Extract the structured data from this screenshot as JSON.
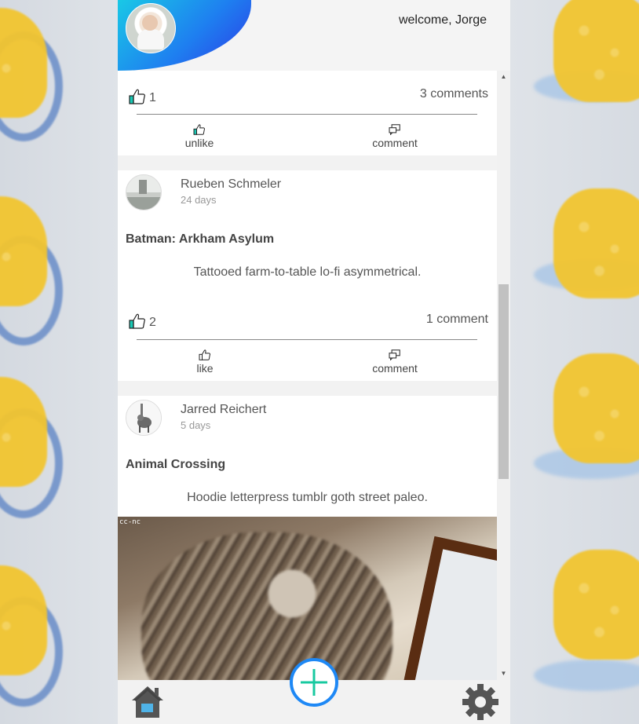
{
  "header": {
    "welcome_text": "welcome, Jorge"
  },
  "posts": [
    {
      "likes": "1",
      "comments_label": "3 comments",
      "like_action_label": "unlike",
      "comment_action_label": "comment"
    },
    {
      "author": "Rueben Schmeler",
      "time": "24 days",
      "title": "Batman: Arkham Asylum",
      "body": "Tattooed farm-to-table lo-fi asymmetrical.",
      "likes": "2",
      "comments_label": "1 comment",
      "like_action_label": "like",
      "comment_action_label": "comment"
    },
    {
      "author": "Jarred Reichert",
      "time": "5 days",
      "title": "Animal Crossing",
      "body": "Hoodie letterpress tumblr goth street paleo.",
      "image_caption": "cc-nc"
    }
  ],
  "colors": {
    "accent": "#1e88f5",
    "like_active": "#19c8b4",
    "add_icon": "#18c9a0"
  },
  "icons": [
    "thumbs-up-icon",
    "comment-icon",
    "home-icon",
    "plus-icon",
    "gear-icon"
  ]
}
